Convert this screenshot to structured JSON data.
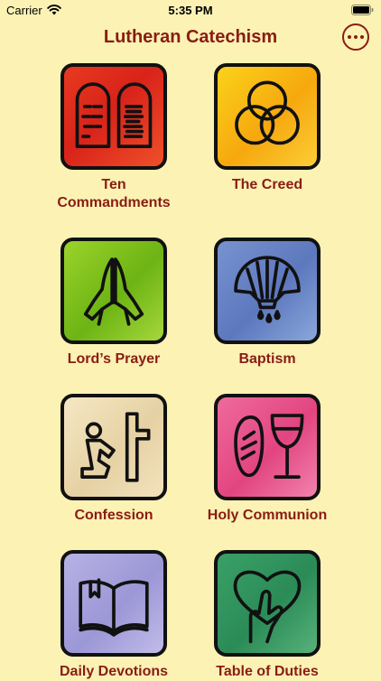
{
  "status_bar": {
    "carrier": "Carrier",
    "time": "5:35 PM"
  },
  "nav": {
    "title": "Lutheran Catechism",
    "more_icon": "ellipsis-circle-icon"
  },
  "tiles": [
    {
      "label_line1": "Ten",
      "label_line2": "Commandments",
      "icon": "tablets-icon",
      "color": "#e0301c"
    },
    {
      "label_line1": "The Creed",
      "label_line2": "",
      "icon": "trinity-rings-icon",
      "color": "#f8bc12"
    },
    {
      "label_line1": "Lord’s Prayer",
      "label_line2": "",
      "icon": "praying-hands-icon",
      "color": "#86c421"
    },
    {
      "label_line1": "Baptism",
      "label_line2": "",
      "icon": "shell-water-icon",
      "color": "#6b86c6"
    },
    {
      "label_line1": "Confession",
      "label_line2": "",
      "icon": "kneeling-cross-icon",
      "color": "#ecdcb4"
    },
    {
      "label_line1": "Holy Communion",
      "label_line2": "",
      "icon": "bread-wine-icon",
      "color": "#e8568e"
    },
    {
      "label_line1": "Daily Devotions",
      "label_line2": "",
      "icon": "open-book-icon",
      "color": "#aca7de"
    },
    {
      "label_line1": "Table of Duties",
      "label_line2": "",
      "icon": "heart-hand-icon",
      "color": "#36986a"
    }
  ]
}
